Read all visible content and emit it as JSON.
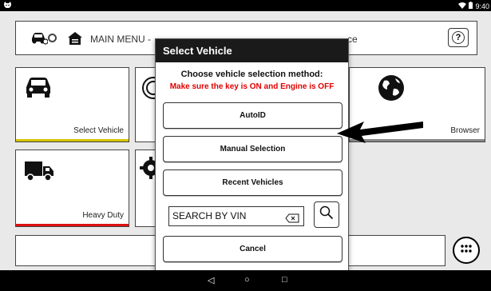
{
  "statusbar": {
    "time": "9:40",
    "left_icon": "notification-cat-icon",
    "right_icons": [
      "wifi-icon",
      "battery-icon"
    ]
  },
  "topbar": {
    "title": "MAIN MENU -",
    "title_end": "ce",
    "icons": [
      "car-info-icon",
      "circle-icon",
      "home-icon",
      "help-icon"
    ],
    "help_label": "?"
  },
  "tiles": [
    {
      "label": "Select Vehicle",
      "icon": "car-icon",
      "bar_color": "#d8c400"
    },
    {
      "label": "Heavy Duty",
      "icon": "truck-icon",
      "bar_color": "#d11"
    },
    {
      "label": "Browser",
      "icon": "globe-icon",
      "bar_color": "#888"
    },
    {
      "label": "",
      "icon": "wheel-icon"
    },
    {
      "label": "",
      "icon": "gear-icon"
    }
  ],
  "modal": {
    "title": "Select Vehicle",
    "prompt": "Choose vehicle selection method:",
    "warning": "Make sure the key is ON and Engine is OFF",
    "buttons": {
      "autoid": "AutoID",
      "manual": "Manual Selection",
      "recent": "Recent Vehicles",
      "cancel": "Cancel"
    },
    "vin_placeholder": "SEARCH BY VIN"
  },
  "nav": {
    "back": "◁",
    "home": "○",
    "recents": "□"
  },
  "colors": {
    "warning": "#e00000",
    "header_bg": "#1a1a1a"
  }
}
